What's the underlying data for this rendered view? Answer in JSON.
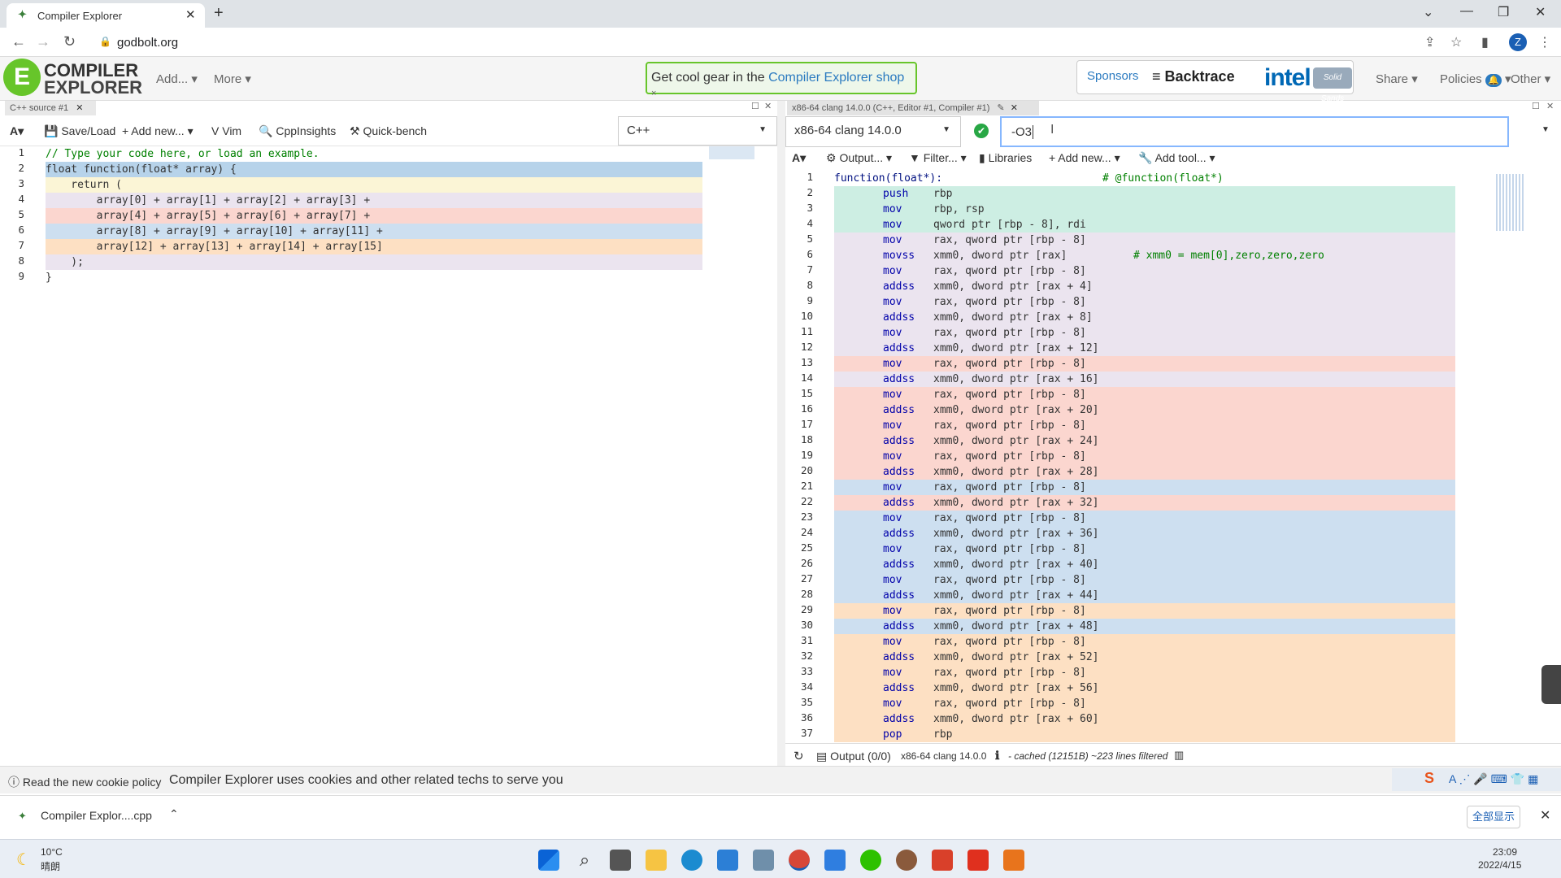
{
  "browser": {
    "tab_title": "Compiler Explorer",
    "url": "godbolt.org"
  },
  "header": {
    "logo_line1": "COMPILER",
    "logo_line2": "EXPLORER",
    "menu_add": "Add...",
    "menu_more": "More",
    "promo_text": "Get cool gear in the ",
    "promo_link": "Compiler Explorer shop",
    "promo_close": "×",
    "sponsors_label": "Sponsors",
    "sponsor_backtrace": "Backtrace",
    "sponsor_intel": "intel",
    "sponsor_solid": "Solid Sands",
    "menu_share": "Share",
    "menu_policies": "Policies",
    "menu_other": "Other"
  },
  "source_pane": {
    "tab_label": "C++ source #1",
    "toolbar": {
      "font": "A",
      "save_load": "Save/Load",
      "add_new": "Add new...",
      "vim": "Vim",
      "cppinsights": "CppInsights",
      "quickbench": "Quick-bench"
    },
    "language": "C++",
    "lines": [
      {
        "n": "1",
        "text": "// Type your code here, or load an example.",
        "hl": ""
      },
      {
        "n": "2",
        "text": "float function(float* array) {",
        "hl": "#b7d3ea"
      },
      {
        "n": "3",
        "text": "    return (",
        "hl": "#fbf5d6"
      },
      {
        "n": "4",
        "text": "        array[0] + array[1] + array[2] + array[3] +",
        "hl": "#ebe4ef"
      },
      {
        "n": "5",
        "text": "        array[4] + array[5] + array[6] + array[7] +",
        "hl": "#fbd6cf"
      },
      {
        "n": "6",
        "text": "        array[8] + array[9] + array[10] + array[11] +",
        "hl": "#cddff0"
      },
      {
        "n": "7",
        "text": "        array[12] + array[13] + array[14] + array[15]",
        "hl": "#fde0c3"
      },
      {
        "n": "8",
        "text": "    );",
        "hl": "#ebe4ef"
      },
      {
        "n": "9",
        "text": "}",
        "hl": ""
      }
    ]
  },
  "compiler_pane": {
    "tab_label": "x86-64 clang 14.0.0 (C++, Editor #1, Compiler #1)",
    "compiler": "x86-64 clang 14.0.0",
    "options": "-O3",
    "toolbar": {
      "font": "A",
      "output": "Output...",
      "filter": "Filter...",
      "libraries": "Libraries",
      "add_new": "Add new...",
      "add_tool": "Add tool..."
    },
    "asm": [
      {
        "n": "1",
        "label": "function(float*):",
        "op": "",
        "args": "",
        "comment": "# @function(float*)",
        "hl": ""
      },
      {
        "n": "2",
        "label": "",
        "op": "push",
        "args": "rbp",
        "comment": "",
        "hl": "#cdeee3"
      },
      {
        "n": "3",
        "label": "",
        "op": "mov",
        "args": "rbp, rsp",
        "comment": "",
        "hl": "#cdeee3"
      },
      {
        "n": "4",
        "label": "",
        "op": "mov",
        "args": "qword ptr [rbp - 8], rdi",
        "comment": "",
        "hl": "#cdeee3"
      },
      {
        "n": "5",
        "label": "",
        "op": "mov",
        "args": "rax, qword ptr [rbp - 8]",
        "comment": "",
        "hl": "#ebe4ef"
      },
      {
        "n": "6",
        "label": "",
        "op": "movss",
        "args": "xmm0, dword ptr [rax]",
        "comment": "# xmm0 = mem[0],zero,zero,zero",
        "hl": "#ebe4ef"
      },
      {
        "n": "7",
        "label": "",
        "op": "mov",
        "args": "rax, qword ptr [rbp - 8]",
        "comment": "",
        "hl": "#ebe4ef"
      },
      {
        "n": "8",
        "label": "",
        "op": "addss",
        "args": "xmm0, dword ptr [rax + 4]",
        "comment": "",
        "hl": "#ebe4ef"
      },
      {
        "n": "9",
        "label": "",
        "op": "mov",
        "args": "rax, qword ptr [rbp - 8]",
        "comment": "",
        "hl": "#ebe4ef"
      },
      {
        "n": "10",
        "label": "",
        "op": "addss",
        "args": "xmm0, dword ptr [rax + 8]",
        "comment": "",
        "hl": "#ebe4ef"
      },
      {
        "n": "11",
        "label": "",
        "op": "mov",
        "args": "rax, qword ptr [rbp - 8]",
        "comment": "",
        "hl": "#ebe4ef"
      },
      {
        "n": "12",
        "label": "",
        "op": "addss",
        "args": "xmm0, dword ptr [rax + 12]",
        "comment": "",
        "hl": "#ebe4ef"
      },
      {
        "n": "13",
        "label": "",
        "op": "mov",
        "args": "rax, qword ptr [rbp - 8]",
        "comment": "",
        "hl": "#fbd6cf"
      },
      {
        "n": "14",
        "label": "",
        "op": "addss",
        "args": "xmm0, dword ptr [rax + 16]",
        "comment": "",
        "hl": "#ebe4ef"
      },
      {
        "n": "15",
        "label": "",
        "op": "mov",
        "args": "rax, qword ptr [rbp - 8]",
        "comment": "",
        "hl": "#fbd6cf"
      },
      {
        "n": "16",
        "label": "",
        "op": "addss",
        "args": "xmm0, dword ptr [rax + 20]",
        "comment": "",
        "hl": "#fbd6cf"
      },
      {
        "n": "17",
        "label": "",
        "op": "mov",
        "args": "rax, qword ptr [rbp - 8]",
        "comment": "",
        "hl": "#fbd6cf"
      },
      {
        "n": "18",
        "label": "",
        "op": "addss",
        "args": "xmm0, dword ptr [rax + 24]",
        "comment": "",
        "hl": "#fbd6cf"
      },
      {
        "n": "19",
        "label": "",
        "op": "mov",
        "args": "rax, qword ptr [rbp - 8]",
        "comment": "",
        "hl": "#fbd6cf"
      },
      {
        "n": "20",
        "label": "",
        "op": "addss",
        "args": "xmm0, dword ptr [rax + 28]",
        "comment": "",
        "hl": "#fbd6cf"
      },
      {
        "n": "21",
        "label": "",
        "op": "mov",
        "args": "rax, qword ptr [rbp - 8]",
        "comment": "",
        "hl": "#cddff0"
      },
      {
        "n": "22",
        "label": "",
        "op": "addss",
        "args": "xmm0, dword ptr [rax + 32]",
        "comment": "",
        "hl": "#fbd6cf"
      },
      {
        "n": "23",
        "label": "",
        "op": "mov",
        "args": "rax, qword ptr [rbp - 8]",
        "comment": "",
        "hl": "#cddff0"
      },
      {
        "n": "24",
        "label": "",
        "op": "addss",
        "args": "xmm0, dword ptr [rax + 36]",
        "comment": "",
        "hl": "#cddff0"
      },
      {
        "n": "25",
        "label": "",
        "op": "mov",
        "args": "rax, qword ptr [rbp - 8]",
        "comment": "",
        "hl": "#cddff0"
      },
      {
        "n": "26",
        "label": "",
        "op": "addss",
        "args": "xmm0, dword ptr [rax + 40]",
        "comment": "",
        "hl": "#cddff0"
      },
      {
        "n": "27",
        "label": "",
        "op": "mov",
        "args": "rax, qword ptr [rbp - 8]",
        "comment": "",
        "hl": "#cddff0"
      },
      {
        "n": "28",
        "label": "",
        "op": "addss",
        "args": "xmm0, dword ptr [rax + 44]",
        "comment": "",
        "hl": "#cddff0"
      },
      {
        "n": "29",
        "label": "",
        "op": "mov",
        "args": "rax, qword ptr [rbp - 8]",
        "comment": "",
        "hl": "#fde0c3"
      },
      {
        "n": "30",
        "label": "",
        "op": "addss",
        "args": "xmm0, dword ptr [rax + 48]",
        "comment": "",
        "hl": "#cddff0"
      },
      {
        "n": "31",
        "label": "",
        "op": "mov",
        "args": "rax, qword ptr [rbp - 8]",
        "comment": "",
        "hl": "#fde0c3"
      },
      {
        "n": "32",
        "label": "",
        "op": "addss",
        "args": "xmm0, dword ptr [rax + 52]",
        "comment": "",
        "hl": "#fde0c3"
      },
      {
        "n": "33",
        "label": "",
        "op": "mov",
        "args": "rax, qword ptr [rbp - 8]",
        "comment": "",
        "hl": "#fde0c3"
      },
      {
        "n": "34",
        "label": "",
        "op": "addss",
        "args": "xmm0, dword ptr [rax + 56]",
        "comment": "",
        "hl": "#fde0c3"
      },
      {
        "n": "35",
        "label": "",
        "op": "mov",
        "args": "rax, qword ptr [rbp - 8]",
        "comment": "",
        "hl": "#fde0c3"
      },
      {
        "n": "36",
        "label": "",
        "op": "addss",
        "args": "xmm0, dword ptr [rax + 60]",
        "comment": "",
        "hl": "#fde0c3"
      },
      {
        "n": "37",
        "label": "",
        "op": "pop",
        "args": "rbp",
        "comment": "",
        "hl": "#fde0c3"
      }
    ],
    "status": {
      "output": "Output (0/0)",
      "compiler": "x86-64 clang 14.0.0",
      "info": "- cached (12151B) ~223 lines filtered"
    }
  },
  "cookie_bar": {
    "link": "Read the new cookie policy",
    "text": "Compiler Explorer uses cookies and other related techs to serve you"
  },
  "downloads": {
    "file": "Compiler Explor....cpp",
    "show_all": "全部显示"
  },
  "taskbar": {
    "temp": "10°C",
    "weather": "晴朗",
    "time": "23:09",
    "date": "2022/4/15"
  },
  "colors": {
    "accent_green": "#67c52a",
    "link_blue": "#2a7ac0"
  }
}
